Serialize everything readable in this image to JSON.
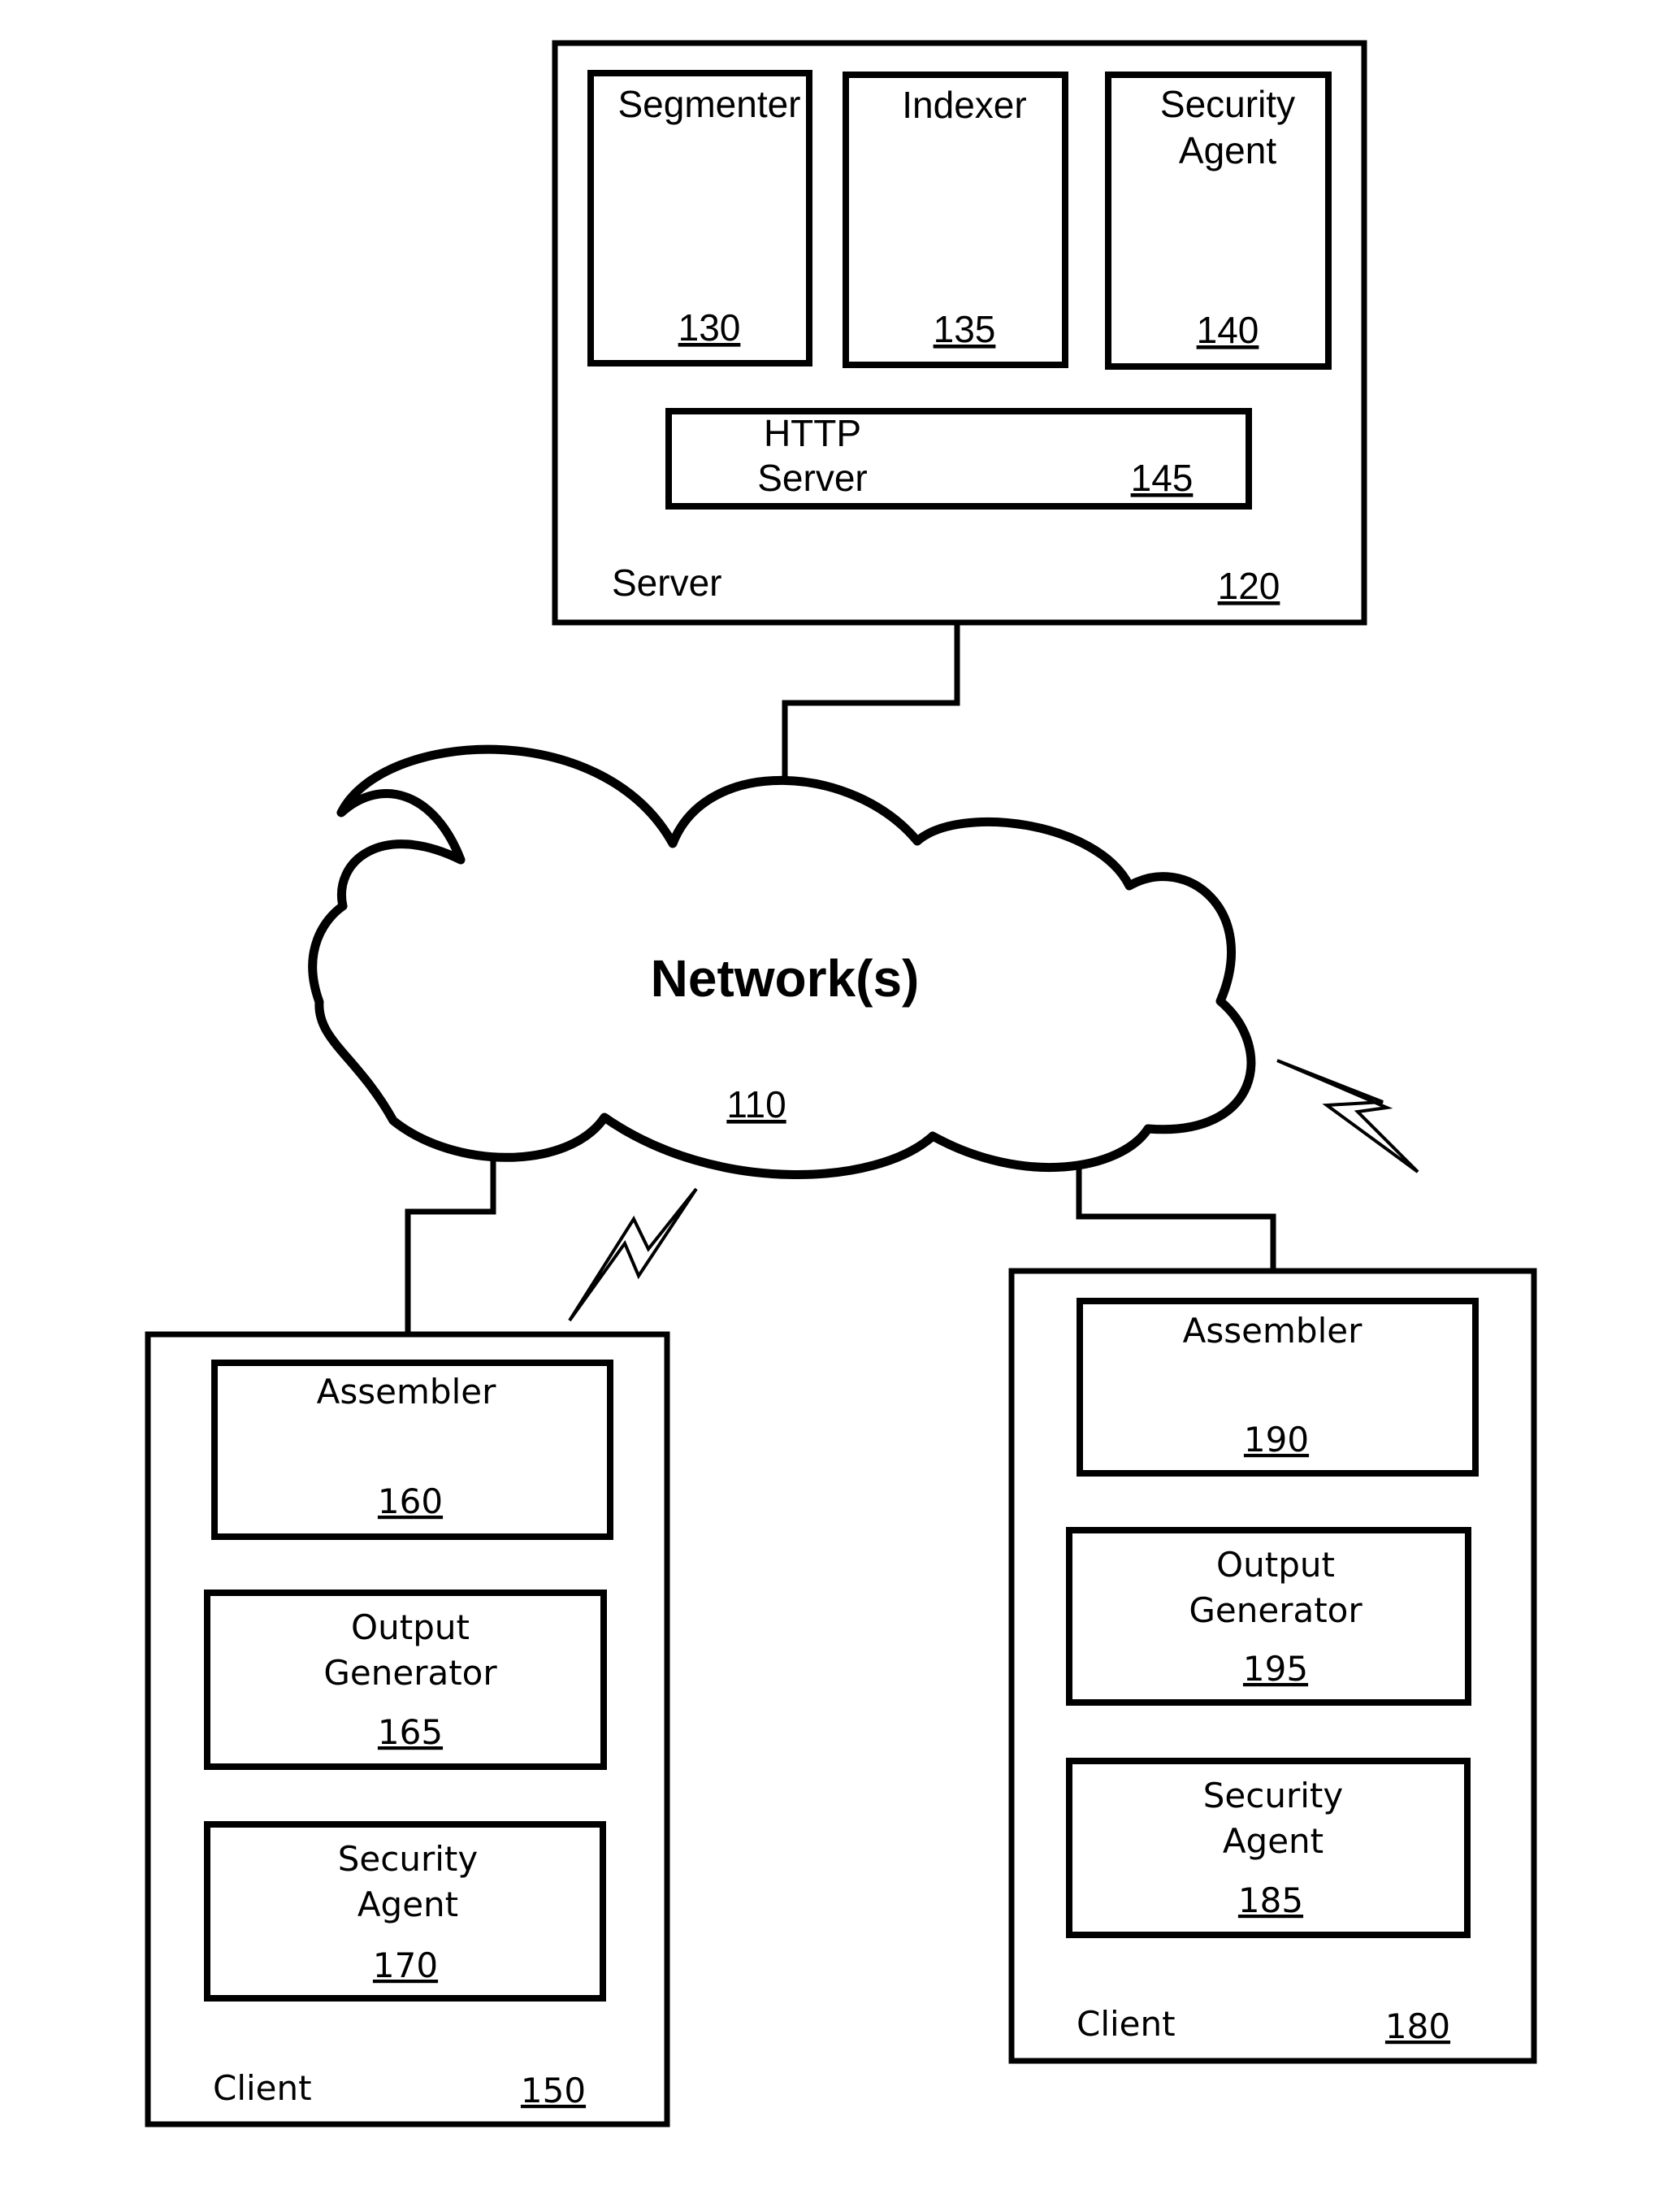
{
  "figure": {
    "server": {
      "label": "Server",
      "ref": "120",
      "components": [
        {
          "label_lines": [
            "Segmenter"
          ],
          "ref": "130"
        },
        {
          "label_lines": [
            "Indexer"
          ],
          "ref": "135"
        },
        {
          "label_lines": [
            "Security",
            "Agent"
          ],
          "ref": "140"
        }
      ],
      "http_server": {
        "label_lines": [
          "HTTP",
          "Server"
        ],
        "ref": "145"
      }
    },
    "network": {
      "label": "Network(s)",
      "ref": "110"
    },
    "client_left": {
      "label": "Client",
      "ref": "150",
      "components": [
        {
          "label_lines": [
            "Assembler"
          ],
          "ref": "160"
        },
        {
          "label_lines": [
            "Output",
            "Generator"
          ],
          "ref": "165"
        },
        {
          "label_lines": [
            "Security",
            "Agent"
          ],
          "ref": "170"
        }
      ]
    },
    "client_right": {
      "label": "Client",
      "ref": "180",
      "components": [
        {
          "label_lines": [
            "Assembler"
          ],
          "ref": "190"
        },
        {
          "label_lines": [
            "Output",
            "Generator"
          ],
          "ref": "195"
        },
        {
          "label_lines": [
            "Security",
            "Agent"
          ],
          "ref": "185"
        }
      ]
    }
  }
}
